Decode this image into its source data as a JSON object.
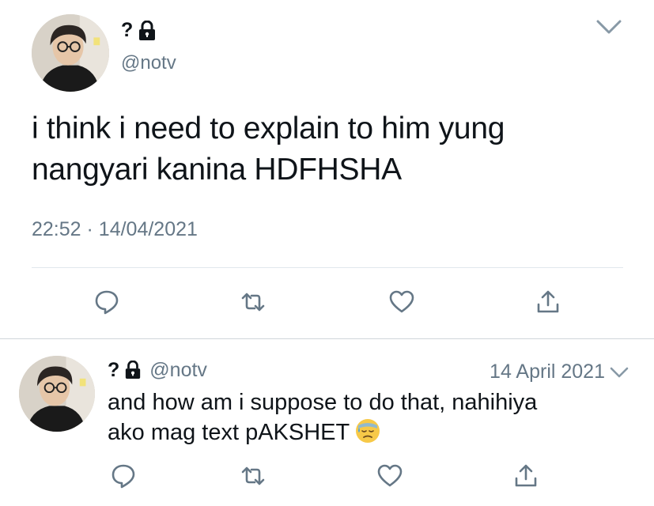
{
  "main_tweet": {
    "display_name": "?",
    "handle": "@notv",
    "text_lines": [
      "i think i need to explain to him yung",
      "nangyari kanina HDFHSHA"
    ],
    "time": "22:52",
    "separator": "·",
    "date": "14/04/2021",
    "actions": [
      "reply-icon",
      "retweet-icon",
      "like-icon",
      "share-icon"
    ]
  },
  "reply_tweet": {
    "display_name": "?",
    "handle": "@notv",
    "date": "14 April 2021",
    "text_lines": [
      "and how am i suppose to do that, nahihiya",
      "ako mag text pAKSHET"
    ],
    "emoji": "downcast-face-with-sweat",
    "actions": [
      "reply-icon",
      "retweet-icon",
      "like-icon",
      "share-icon"
    ]
  },
  "colors": {
    "text": "#0f1419",
    "secondary": "#657786",
    "divider": "#e1e8ed",
    "icon": "#657786"
  }
}
